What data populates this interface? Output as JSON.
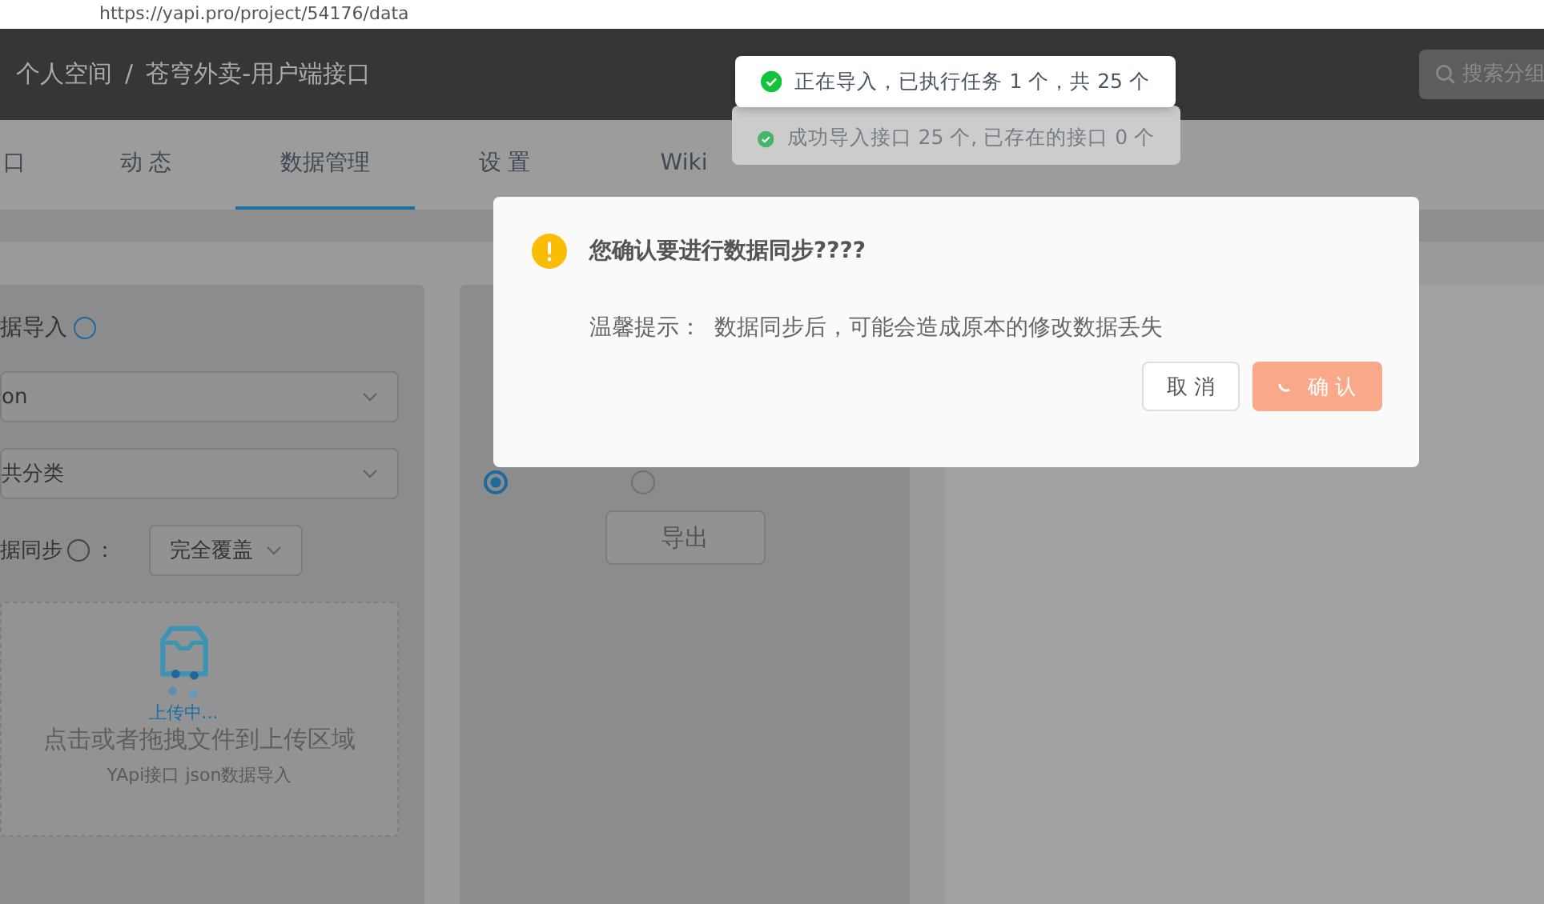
{
  "browser": {
    "url": "https://yapi.pro/project/54176/data"
  },
  "header": {
    "breadcrumb": [
      "个人空间",
      "苍穹外卖-用户端接口"
    ],
    "separator": "/",
    "search": {
      "placeholder": "搜索分组"
    }
  },
  "tabs": [
    {
      "label": "口",
      "selected": false
    },
    {
      "label": "动 态",
      "selected": false
    },
    {
      "label": "数据管理",
      "selected": true
    },
    {
      "label": "设 置",
      "selected": false
    },
    {
      "label": "Wiki",
      "selected": false
    }
  ],
  "import_panel": {
    "title": "据导入",
    "selects": [
      "on",
      "共分类"
    ],
    "sync_label": "据同步",
    "sync_colon": "：",
    "sync_mode": "完全覆盖",
    "upload": {
      "status": "上传中...",
      "hint": "点击或者拖拽文件到上传区域",
      "subhint": "YApi接口 json数据导入"
    }
  },
  "export_panel": {
    "radios": [
      {
        "selected": true
      },
      {
        "selected": false
      }
    ],
    "button": "导出"
  },
  "toasts": [
    {
      "text": "正在导入，已执行任务 1 个，共 25 个",
      "fading": false
    },
    {
      "text": "成功导入接口 25 个, 已存在的接口 0 个",
      "fading": true
    }
  ],
  "dialog": {
    "title": "您确认要进行数据同步????",
    "tip_label": "温馨提示：",
    "tip": "数据同步后，可能会造成原本的修改数据丢失",
    "buttons": [
      {
        "label": "取 消",
        "kind": "default",
        "loading": false
      },
      {
        "label": "确 认",
        "kind": "primary",
        "loading": true
      }
    ]
  }
}
